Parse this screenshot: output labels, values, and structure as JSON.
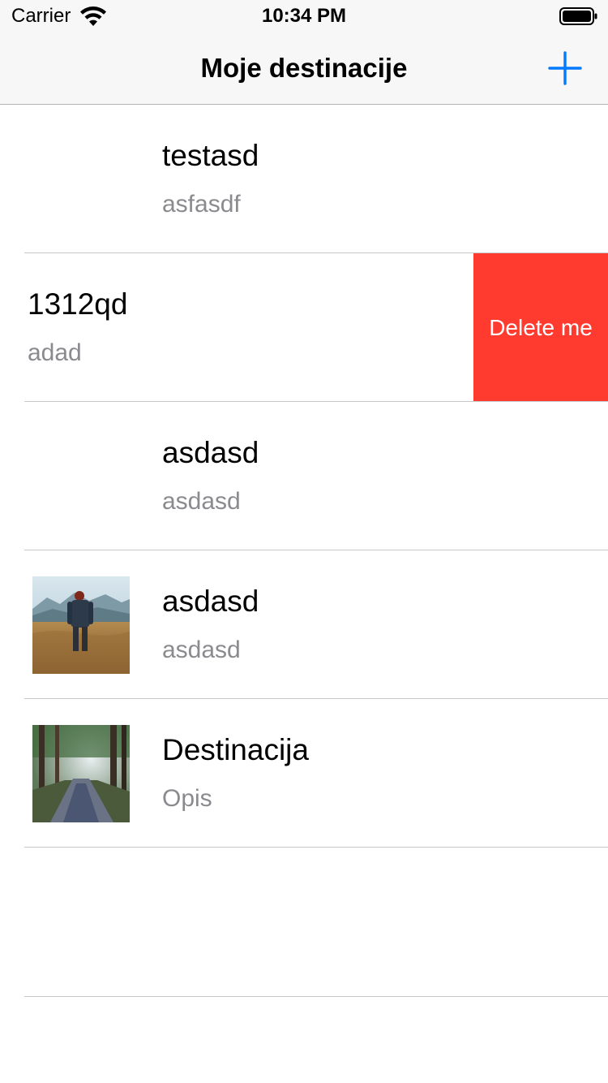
{
  "status_bar": {
    "carrier": "Carrier",
    "time": "10:34 PM"
  },
  "nav": {
    "title": "Moje destinacije",
    "add_icon": "plus-icon",
    "accent_color": "#007aff"
  },
  "rows": [
    {
      "title": "testasd",
      "subtitle": "asfasdf",
      "thumbnail": null
    },
    {
      "title": "1312qd",
      "subtitle": "adad",
      "thumbnail": null,
      "swiped": true,
      "action_label": "Delete me",
      "action_color": "#ff3b30"
    },
    {
      "title": "asdasd",
      "subtitle": "asdasd",
      "thumbnail": null
    },
    {
      "title": "asdasd",
      "subtitle": "asdasd",
      "thumbnail": "person-in-field-photo"
    },
    {
      "title": "Destinacija",
      "subtitle": "Opis",
      "thumbnail": "forest-road-photo"
    }
  ]
}
